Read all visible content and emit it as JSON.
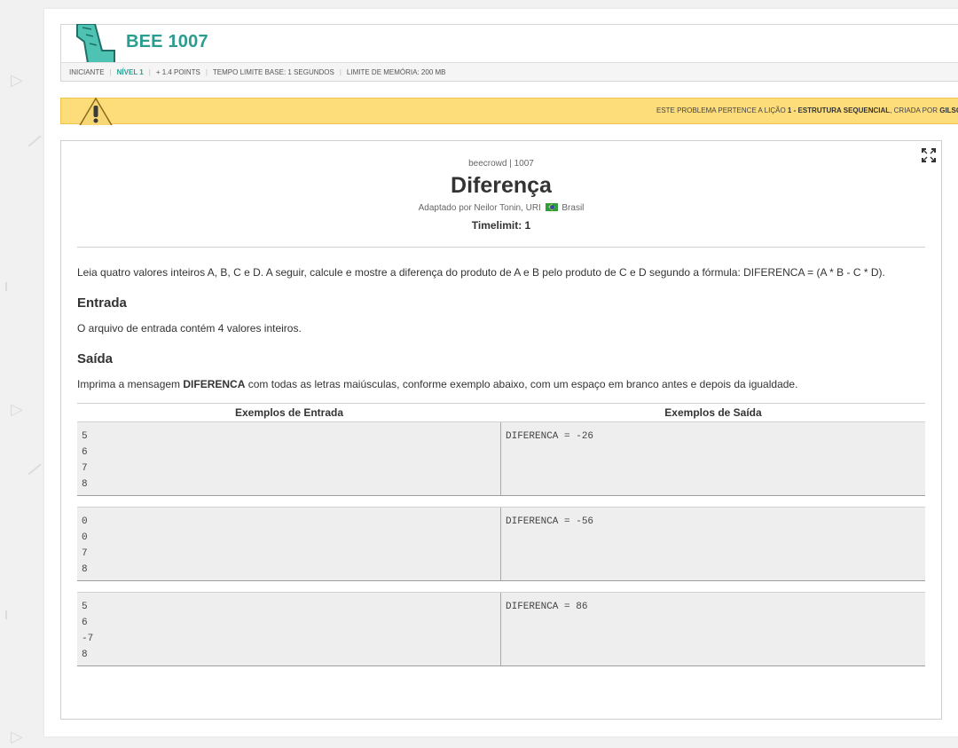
{
  "header": {
    "title": "BEE 1007",
    "meta": {
      "category": "INICIANTE",
      "level": "NÍVEL 1",
      "points": "+ 1.4 POINTS",
      "time_limit": "TEMPO LIMITE BASE: 1 SEGUNDOS",
      "memory_limit": "LIMITE DE MEMÓRIA: 200 MB"
    }
  },
  "lesson": {
    "prefix": "ESTE PROBLEMA PERTENCE A LIÇÃO",
    "lesson_name": "1 - ESTRUTURA SEQUENCIAL",
    "middle": ", CRIADA POR",
    "author": "GILSON F"
  },
  "problem": {
    "source": "beecrowd | 1007",
    "title": "Diferença",
    "adapted_prefix": "Adaptado por Neilor Tonin, URI",
    "country": "Brasil",
    "timelimit": "Timelimit: 1",
    "description": "Leia quatro valores inteiros A, B, C e D. A seguir, calcule e mostre a diferença do produto de A e B pelo produto de C e D segundo a fórmula: DIFERENCA = (A * B - C * D).",
    "input_heading": "Entrada",
    "input_text": "O arquivo de entrada contém 4 valores inteiros.",
    "output_heading": "Saída",
    "output_prefix": "Imprima a mensagem",
    "output_bold": "DIFERENCA",
    "output_suffix": "com todas as letras maiúsculas, conforme exemplo abaixo, com um espaço em branco antes e depois da igualdade."
  },
  "examples": {
    "input_header": "Exemplos de Entrada",
    "output_header": "Exemplos de Saída",
    "cases": [
      {
        "input": "5\n6\n7\n8",
        "output": "DIFERENCA = -26"
      },
      {
        "input": "0\n0\n7\n8",
        "output": "DIFERENCA = -56"
      },
      {
        "input": "5\n6\n-7\n8",
        "output": "DIFERENCA = 86"
      }
    ]
  },
  "icons": {
    "logo": "bee-logo-icon",
    "warning": "warning-icon",
    "expand": "expand-icon",
    "flag": "brazil-flag-icon"
  },
  "colors": {
    "accent": "#2a9d8f",
    "lesson_bar": "#fddc7a",
    "example_bg": "#eeeeee"
  }
}
